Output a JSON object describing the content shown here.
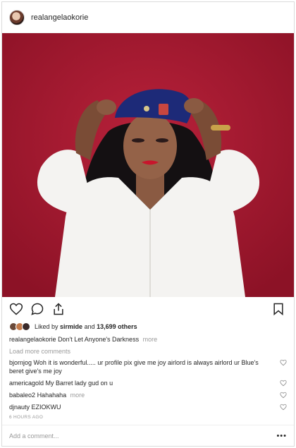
{
  "post": {
    "username": "realangelaokorie",
    "likes": {
      "prefix": "Liked by",
      "user": "sirmide",
      "joiner": "and",
      "others": "13,699 others"
    },
    "caption": {
      "username": "realangelaokorie",
      "text": "Don't Let Anyone's Darkness",
      "more": "more"
    },
    "load_more": "Load more comments",
    "comments": [
      {
        "username": "bjornjog",
        "text": "Woh it is wonderful..... ur profile pix give me joy airlord is always airlord ur Blue's beret give's me joy",
        "more": ""
      },
      {
        "username": "americagold",
        "text": "My Barret lady gud on u",
        "more": ""
      },
      {
        "username": "babaleo2",
        "text": "Hahahaha",
        "more": "more"
      },
      {
        "username": "djnauty",
        "text": "EZIOKWU",
        "more": ""
      }
    ],
    "timestamp": "6 HOURS AGO",
    "add_comment_placeholder": "Add a comment...",
    "options_glyph": "•••"
  },
  "icons": {
    "like": "heart-icon",
    "comment": "comment-bubble-icon",
    "share": "share-icon",
    "save": "bookmark-icon",
    "comment_like": "small-heart-icon"
  },
  "colors": {
    "background_red": "#a8192f",
    "muted_text": "#999999",
    "border": "#dbdbdb"
  }
}
